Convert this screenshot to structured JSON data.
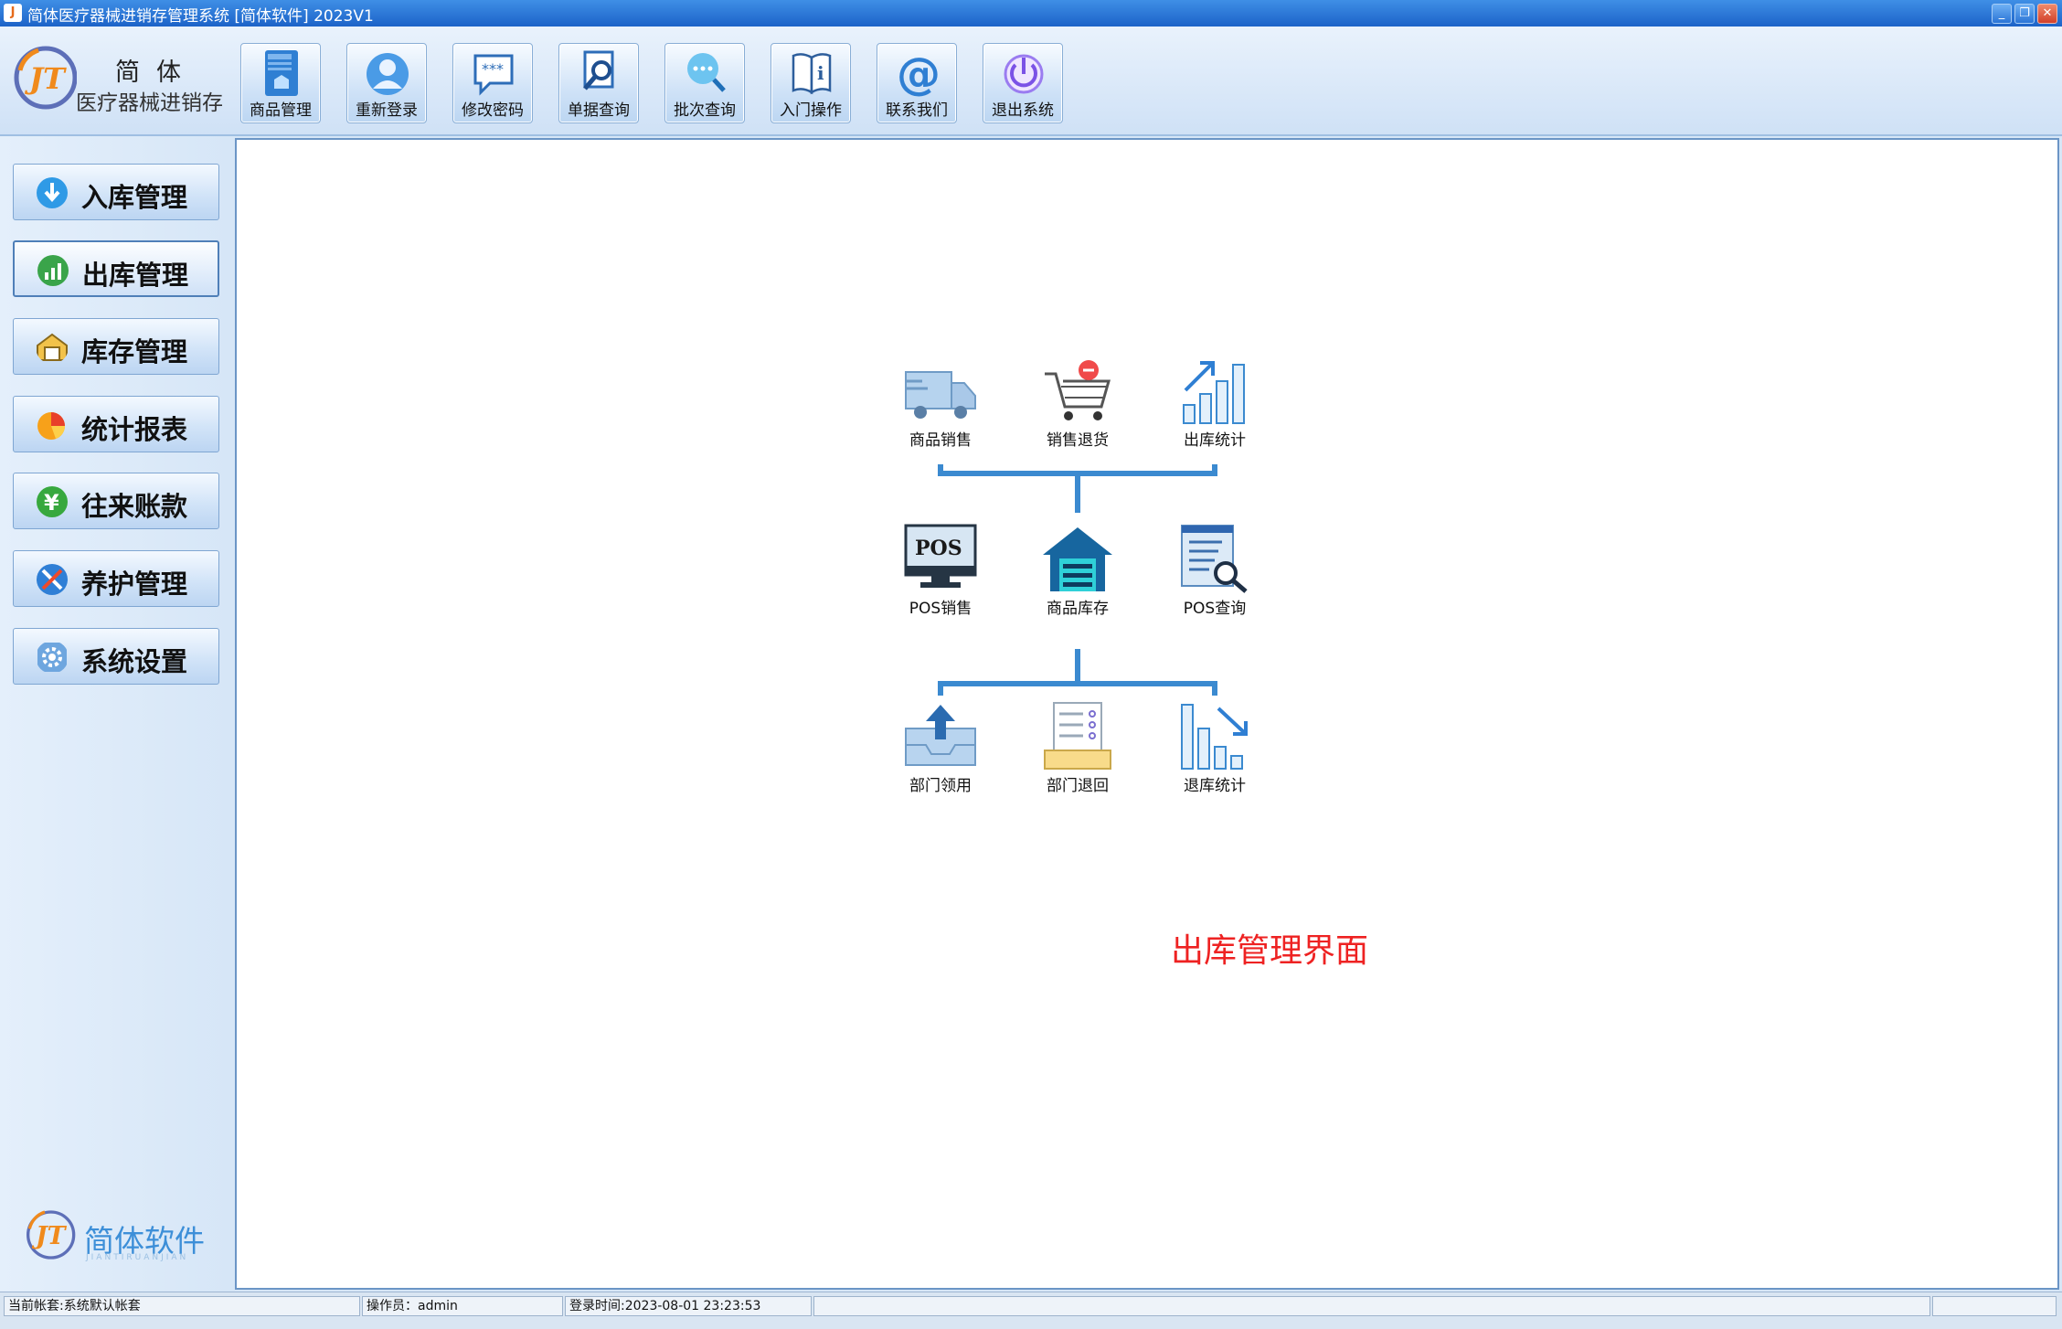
{
  "window": {
    "title": "简体医疗器械进销存管理系统 [简体软件] 2023V1",
    "min_glyph": "_",
    "max_glyph": "❐",
    "close_glyph": "✕"
  },
  "brand": {
    "logo_text": "JT",
    "name_line1": "简体",
    "name_line2": "医疗器械进销存"
  },
  "toolbar": [
    {
      "label": "商品管理",
      "icon": "goods-book-icon"
    },
    {
      "label": "重新登录",
      "icon": "user-avatar-icon"
    },
    {
      "label": "修改密码",
      "icon": "password-bubble-icon"
    },
    {
      "label": "单据查询",
      "icon": "document-search-icon"
    },
    {
      "label": "批次查询",
      "icon": "batch-search-icon"
    },
    {
      "label": "入门操作",
      "icon": "info-book-icon"
    },
    {
      "label": "联系我们",
      "icon": "at-sign-icon"
    },
    {
      "label": "退出系统",
      "icon": "power-icon"
    }
  ],
  "sidebar": {
    "items": [
      {
        "label": "入库管理",
        "icon": "arrow-down-icon",
        "active": false
      },
      {
        "label": "出库管理",
        "icon": "bar-chart-icon",
        "active": true
      },
      {
        "label": "库存管理",
        "icon": "warehouse-box-icon",
        "active": false
      },
      {
        "label": "统计报表",
        "icon": "pie-chart-icon",
        "active": false
      },
      {
        "label": "往来账款",
        "icon": "yen-icon",
        "active": false
      },
      {
        "label": "养护管理",
        "icon": "tools-icon",
        "active": false
      },
      {
        "label": "系统设置",
        "icon": "gear-icon",
        "active": false
      }
    ],
    "brand_text": "简体软件",
    "brand_sub": "JIANTIRUANJIAN"
  },
  "main": {
    "flow": {
      "top": [
        {
          "label": "商品销售",
          "icon": "delivery-truck-icon"
        },
        {
          "label": "销售退货",
          "icon": "cart-return-icon"
        },
        {
          "label": "出库统计",
          "icon": "rising-chart-icon"
        }
      ],
      "middle": [
        {
          "label": "POS销售",
          "icon": "pos-monitor-icon"
        },
        {
          "label": "商品库存",
          "icon": "warehouse-icon"
        },
        {
          "label": "POS查询",
          "icon": "list-search-icon"
        }
      ],
      "bottom": [
        {
          "label": "部门领用",
          "icon": "tray-upload-icon"
        },
        {
          "label": "部门退回",
          "icon": "checklist-tray-icon"
        },
        {
          "label": "退库统计",
          "icon": "falling-chart-icon"
        }
      ]
    },
    "pos_text": "POS",
    "caption": "出库管理界面"
  },
  "statusbar": {
    "account": "当前帐套:系统默认帐套",
    "operator": "操作员：admin",
    "login_time": "登录时间:2023-08-01 23:23:53",
    "empty1": "",
    "empty2": ""
  },
  "colors": {
    "accent": "#3b8ad0",
    "caption": "#ee2222",
    "title_bar": "#2a74d6"
  }
}
